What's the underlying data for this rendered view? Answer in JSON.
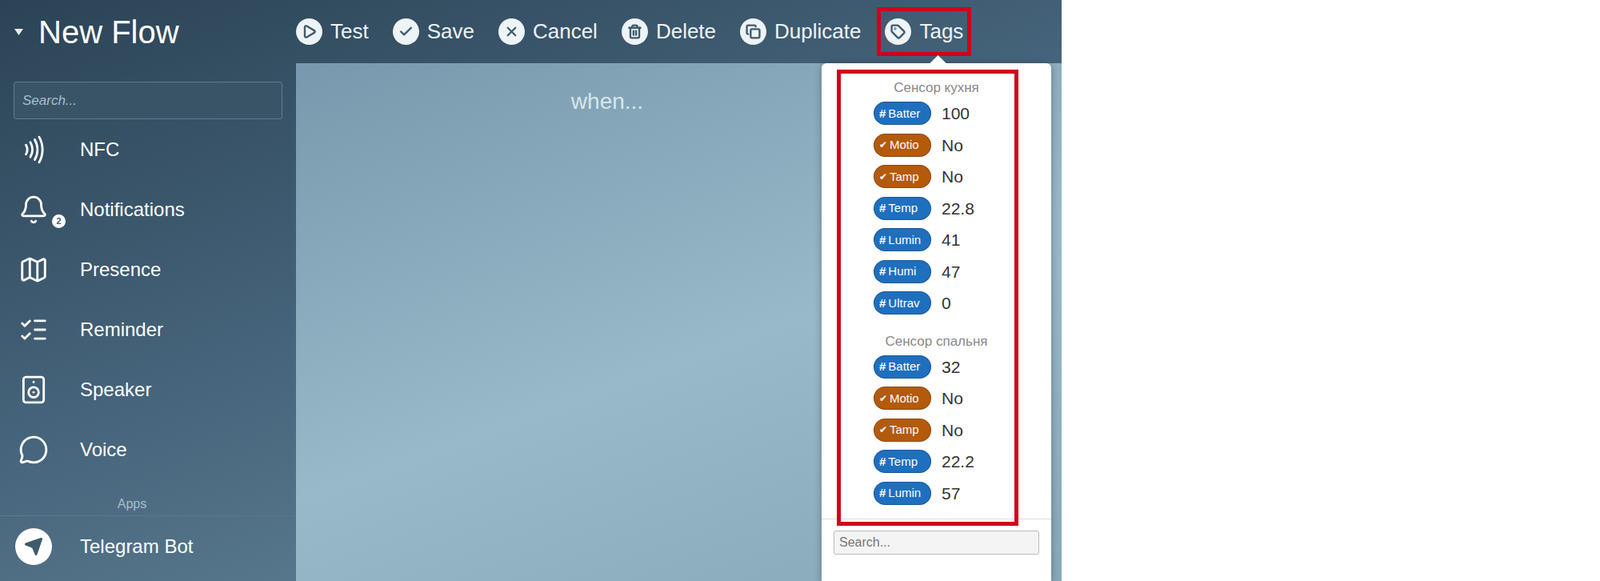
{
  "window": {
    "title": "New Flow"
  },
  "toolbar": [
    {
      "label": "Test",
      "highlighted": false
    },
    {
      "label": "Save",
      "highlighted": false
    },
    {
      "label": "Cancel",
      "highlighted": false
    },
    {
      "label": "Delete",
      "highlighted": false
    },
    {
      "label": "Duplicate",
      "highlighted": false
    },
    {
      "label": "Tags",
      "highlighted": true
    }
  ],
  "sidebar": {
    "search": {
      "placeholder": "Search..."
    },
    "items": [
      {
        "label": "NFC"
      },
      {
        "label": "Notifications",
        "badge": "2"
      },
      {
        "label": "Presence"
      },
      {
        "label": "Reminder"
      },
      {
        "label": "Speaker"
      },
      {
        "label": "Voice"
      }
    ],
    "sections": [
      {
        "title": "Apps",
        "items": [
          {
            "label": "Telegram Bot"
          }
        ]
      }
    ]
  },
  "canvas": {
    "placeholder": "when..."
  },
  "tags_panel": {
    "open": true,
    "highlighted": true,
    "groups": [
      {
        "title": "Сенсор кухня",
        "tags": [
          {
            "name": "Batter",
            "kind": "number",
            "symbol": "#",
            "color": "#1f6fbf",
            "value": "100"
          },
          {
            "name": "Motio",
            "kind": "boolean",
            "symbol": "✔",
            "color": "#b45a0c",
            "value": "No"
          },
          {
            "name": "Tamp",
            "kind": "boolean",
            "symbol": "✔",
            "color": "#b45a0c",
            "value": "No"
          },
          {
            "name": "Temp",
            "kind": "number",
            "symbol": "#",
            "color": "#1f6fbf",
            "value": "22.8"
          },
          {
            "name": "Lumin",
            "kind": "number",
            "symbol": "#",
            "color": "#1f6fbf",
            "value": "41"
          },
          {
            "name": "Humi",
            "kind": "number",
            "symbol": "#",
            "color": "#1f6fbf",
            "value": "47"
          },
          {
            "name": "Ultrav",
            "kind": "number",
            "symbol": "#",
            "color": "#1f6fbf",
            "value": "0"
          }
        ]
      },
      {
        "title": "Сенсор спальня",
        "tags": [
          {
            "name": "Batter",
            "kind": "number",
            "symbol": "#",
            "color": "#1f6fbf",
            "value": "32"
          },
          {
            "name": "Motio",
            "kind": "boolean",
            "symbol": "✔",
            "color": "#b45a0c",
            "value": "No"
          },
          {
            "name": "Tamp",
            "kind": "boolean",
            "symbol": "✔",
            "color": "#b45a0c",
            "value": "No"
          },
          {
            "name": "Temp",
            "kind": "number",
            "symbol": "#",
            "color": "#1f6fbf",
            "value": "22.2"
          },
          {
            "name": "Lumin",
            "kind": "number",
            "symbol": "#",
            "color": "#1f6fbf",
            "value": "57"
          }
        ]
      }
    ],
    "search": {
      "placeholder": "Search..."
    }
  }
}
